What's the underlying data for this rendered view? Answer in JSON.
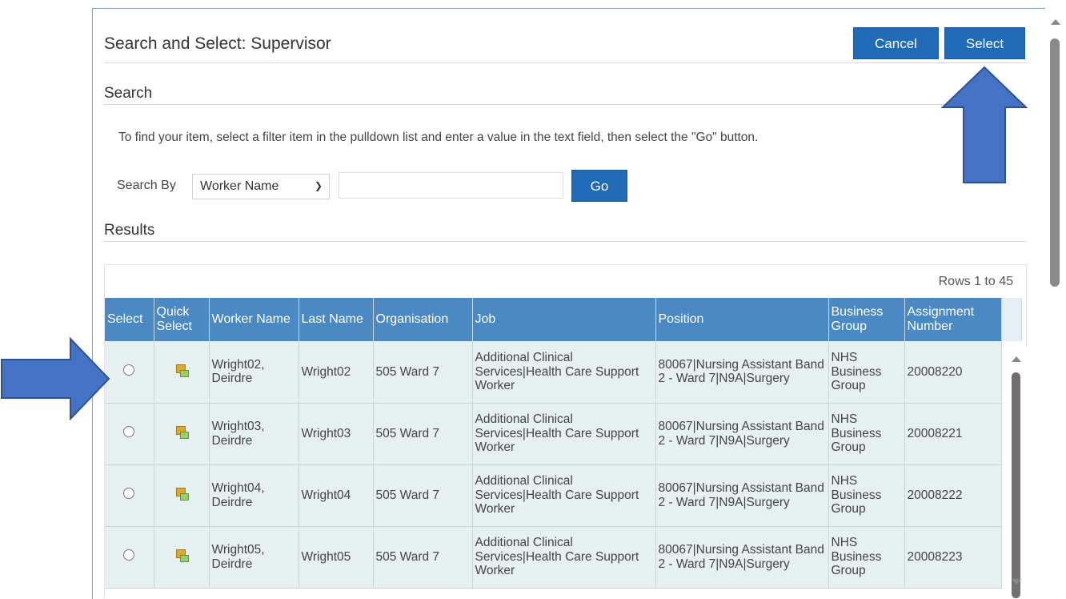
{
  "dialog": {
    "title": "Search and Select: Supervisor",
    "cancel_label": "Cancel",
    "select_label": "Select"
  },
  "search": {
    "heading": "Search",
    "instructions": "To find your item, select a filter item in the pulldown list and enter a value in the text field, then select the \"Go\" button.",
    "search_by_label": "Search By",
    "filter_value": "Worker Name",
    "input_value": "",
    "go_label": "Go"
  },
  "results": {
    "heading": "Results",
    "rows_info": "Rows 1 to 45",
    "columns": [
      "Select",
      "Quick Select",
      "Worker Name",
      "Last Name",
      "Organisation",
      "Job",
      "Position",
      "Business Group",
      "Assignment Number"
    ],
    "rows": [
      {
        "worker_name": "Wright02, Deirdre",
        "last_name": "Wright02",
        "organisation": "505 Ward 7",
        "job": "Additional Clinical Services|Health Care Support Worker",
        "position": "80067|Nursing Assistant Band 2 - Ward 7|N9A|Surgery",
        "business_group": "NHS Business Group",
        "assignment_number": "20008220"
      },
      {
        "worker_name": "Wright03, Deirdre",
        "last_name": "Wright03",
        "organisation": "505 Ward 7",
        "job": "Additional Clinical Services|Health Care Support Worker",
        "position": "80067|Nursing Assistant Band 2 - Ward 7|N9A|Surgery",
        "business_group": "NHS Business Group",
        "assignment_number": "20008221"
      },
      {
        "worker_name": "Wright04, Deirdre",
        "last_name": "Wright04",
        "organisation": "505 Ward 7",
        "job": "Additional Clinical Services|Health Care Support Worker",
        "position": "80067|Nursing Assistant Band 2 - Ward 7|N9A|Surgery",
        "business_group": "NHS Business Group",
        "assignment_number": "20008222"
      },
      {
        "worker_name": "Wright05, Deirdre",
        "last_name": "Wright05",
        "organisation": "505 Ward 7",
        "job": "Additional Clinical Services|Health Care Support Worker",
        "position": "80067|Nursing Assistant Band 2 - Ward 7|N9A|Surgery",
        "business_group": "NHS Business Group",
        "assignment_number": "20008223"
      }
    ]
  },
  "colors": {
    "header_blue": "#4a89c3",
    "button_blue": "#1f6bb5",
    "row_bg": "#e6f0f0",
    "annotation_arrow": "#4472c4"
  },
  "icons": {
    "quick_select": "quick-select-icon",
    "dropdown": "chevron-down-icon"
  }
}
